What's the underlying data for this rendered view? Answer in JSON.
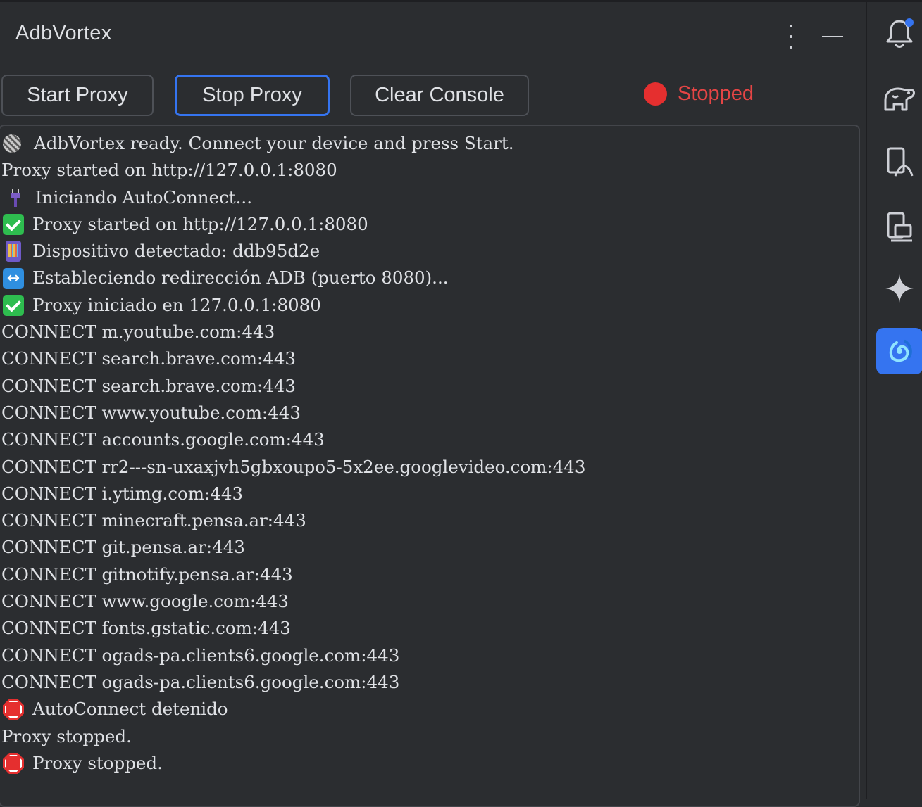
{
  "window": {
    "title": "AdbVortex"
  },
  "header": {
    "more_icon": "more-vertical-icon",
    "minimize_icon": "minimize-icon"
  },
  "toolbar": {
    "start_label": "Start Proxy",
    "stop_label": "Stop Proxy",
    "clear_label": "Clear Console",
    "status_text": "Stopped",
    "status_color": "#e52f2f",
    "accent_color": "#3574f0"
  },
  "console": {
    "lines": [
      {
        "icon": "globe-icon",
        "text": "AdbVortex ready. Connect your device and press Start."
      },
      {
        "icon": "",
        "text": "Proxy started on http://127.0.0.1:8080"
      },
      {
        "icon": "plug-icon",
        "text": "Iniciando AutoConnect..."
      },
      {
        "icon": "check-icon",
        "text": "Proxy started on http://127.0.0.1:8080"
      },
      {
        "icon": "phone-icon",
        "text": "Dispositivo detectado: ddb95d2e"
      },
      {
        "icon": "left-right-arrow-icon",
        "text": "Estableciendo redirección ADB (puerto 8080)..."
      },
      {
        "icon": "check-icon",
        "text": "Proxy iniciado en 127.0.0.1:8080"
      },
      {
        "icon": "",
        "text": "CONNECT m.youtube.com:443"
      },
      {
        "icon": "",
        "text": "CONNECT search.brave.com:443"
      },
      {
        "icon": "",
        "text": "CONNECT search.brave.com:443"
      },
      {
        "icon": "",
        "text": "CONNECT www.youtube.com:443"
      },
      {
        "icon": "",
        "text": "CONNECT accounts.google.com:443"
      },
      {
        "icon": "",
        "text": "CONNECT rr2---sn-uxaxjvh5gbxoupo5-5x2ee.googlevideo.com:443"
      },
      {
        "icon": "",
        "text": "CONNECT i.ytimg.com:443"
      },
      {
        "icon": "",
        "text": "CONNECT minecraft.pensa.ar:443"
      },
      {
        "icon": "",
        "text": "CONNECT git.pensa.ar:443"
      },
      {
        "icon": "",
        "text": "CONNECT gitnotify.pensa.ar:443"
      },
      {
        "icon": "",
        "text": "CONNECT www.google.com:443"
      },
      {
        "icon": "",
        "text": "CONNECT fonts.gstatic.com:443"
      },
      {
        "icon": "",
        "text": "CONNECT ogads-pa.clients6.google.com:443"
      },
      {
        "icon": "",
        "text": "CONNECT ogads-pa.clients6.google.com:443"
      },
      {
        "icon": "stop-sign-icon",
        "text": "AutoConnect detenido"
      },
      {
        "icon": "",
        "text": "Proxy stopped."
      },
      {
        "icon": "stop-sign-icon",
        "text": "Proxy stopped."
      }
    ]
  },
  "sidebar": {
    "items": [
      {
        "icon": "notifications-icon",
        "badge_color": "#3574f0"
      },
      {
        "icon": "gradle-elephant-icon"
      },
      {
        "icon": "device-manager-icon"
      },
      {
        "icon": "running-devices-icon"
      },
      {
        "icon": "gemini-sparkle-icon"
      },
      {
        "icon": "adbvortex-swirl-icon",
        "active": true
      }
    ]
  }
}
